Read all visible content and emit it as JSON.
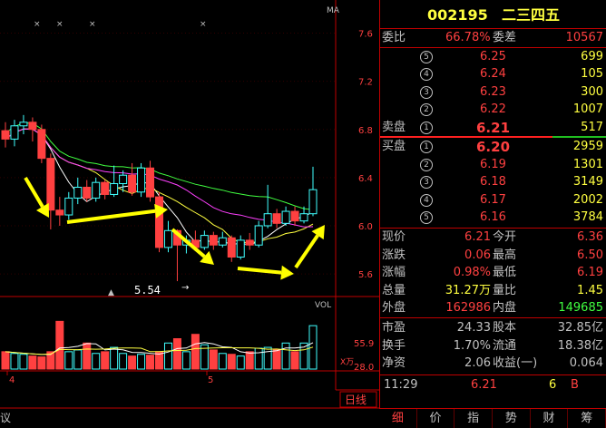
{
  "chart": {
    "ma_label": "MA",
    "price_ticks": [
      "7.6",
      "7.2",
      "6.8",
      "6.4",
      "6.0",
      "5.6"
    ],
    "vol_label": "VOL",
    "vol_ticks": [
      "55.9",
      "28.0"
    ],
    "vol_unit": "X万",
    "low_marker": "5.54",
    "date_labels": [
      "4",
      "5"
    ],
    "bottom_left": "议",
    "period_label": "日线",
    "up_color": "#40ffff",
    "down_color": "#ff4040"
  },
  "chart_data": {
    "type": "candlestick",
    "y_range": [
      5.45,
      7.8
    ],
    "candles": [
      {
        "o": 6.79,
        "c": 6.72,
        "h": 6.86,
        "l": 6.65
      },
      {
        "o": 6.72,
        "c": 6.83,
        "h": 6.88,
        "l": 6.66
      },
      {
        "o": 6.83,
        "c": 6.86,
        "h": 6.92,
        "l": 6.76
      },
      {
        "o": 6.86,
        "c": 6.8,
        "h": 6.9,
        "l": 6.7
      },
      {
        "o": 6.8,
        "c": 6.56,
        "h": 6.84,
        "l": 6.52
      },
      {
        "o": 6.56,
        "c": 6.13,
        "h": 6.6,
        "l": 5.97
      },
      {
        "o": 6.13,
        "c": 6.09,
        "h": 6.24,
        "l": 6.0
      },
      {
        "o": 6.09,
        "c": 6.23,
        "h": 6.28,
        "l": 6.05
      },
      {
        "o": 6.23,
        "c": 6.32,
        "h": 6.4,
        "l": 6.18
      },
      {
        "o": 6.32,
        "c": 6.23,
        "h": 6.38,
        "l": 6.2
      },
      {
        "o": 6.23,
        "c": 6.36,
        "h": 6.4,
        "l": 6.2
      },
      {
        "o": 6.36,
        "c": 6.26,
        "h": 6.38,
        "l": 6.22
      },
      {
        "o": 6.26,
        "c": 6.35,
        "h": 6.5,
        "l": 6.24
      },
      {
        "o": 6.35,
        "c": 6.42,
        "h": 6.46,
        "l": 6.28
      },
      {
        "o": 6.42,
        "c": 6.28,
        "h": 6.52,
        "l": 6.25
      },
      {
        "o": 6.28,
        "c": 6.48,
        "h": 6.52,
        "l": 6.24
      },
      {
        "o": 6.48,
        "c": 6.24,
        "h": 6.54,
        "l": 6.2
      },
      {
        "o": 6.24,
        "c": 5.82,
        "h": 6.28,
        "l": 5.78
      },
      {
        "o": 5.82,
        "c": 5.96,
        "h": 6.04,
        "l": 5.78
      },
      {
        "o": 5.96,
        "c": 5.84,
        "h": 5.97,
        "l": 5.54
      },
      {
        "o": 5.84,
        "c": 5.88,
        "h": 5.92,
        "l": 5.77
      },
      {
        "o": 5.88,
        "c": 5.82,
        "h": 5.96,
        "l": 5.79
      },
      {
        "o": 5.82,
        "c": 5.92,
        "h": 5.96,
        "l": 5.8
      },
      {
        "o": 5.92,
        "c": 5.84,
        "h": 5.95,
        "l": 5.8
      },
      {
        "o": 5.84,
        "c": 5.9,
        "h": 5.95,
        "l": 5.82
      },
      {
        "o": 5.9,
        "c": 5.74,
        "h": 5.92,
        "l": 5.7
      },
      {
        "o": 5.74,
        "c": 5.88,
        "h": 5.92,
        "l": 5.72
      },
      {
        "o": 5.88,
        "c": 5.84,
        "h": 5.94,
        "l": 5.8
      },
      {
        "o": 5.84,
        "c": 6.0,
        "h": 6.04,
        "l": 5.82
      },
      {
        "o": 6.0,
        "c": 6.1,
        "h": 6.34,
        "l": 5.98
      },
      {
        "o": 6.1,
        "c": 6.02,
        "h": 6.14,
        "l": 5.98
      },
      {
        "o": 6.02,
        "c": 6.12,
        "h": 6.16,
        "l": 6.0
      },
      {
        "o": 6.12,
        "c": 6.04,
        "h": 6.16,
        "l": 6.0
      },
      {
        "o": 6.04,
        "c": 6.1,
        "h": 6.16,
        "l": 6.02
      },
      {
        "o": 6.1,
        "c": 6.3,
        "h": 6.49,
        "l": 6.08
      }
    ],
    "volume_range": [
      0,
      70
    ],
    "volumes": [
      20,
      18,
      17,
      15,
      14,
      20,
      55,
      20,
      22,
      30,
      18,
      20,
      25,
      18,
      15,
      17,
      16,
      20,
      30,
      35,
      20,
      40,
      28,
      22,
      18,
      17,
      15,
      20,
      24,
      25,
      22,
      30,
      20,
      30,
      50
    ]
  },
  "quote": {
    "code": "002195",
    "name": "二三四五",
    "webi_label": "委比",
    "webi_value": "66.78%",
    "weicha_label": "委差",
    "weicha_value": "10567",
    "sell_label": "卖盘",
    "buy_label": "买盘",
    "sells": [
      {
        "n": "5",
        "price": "6.25",
        "vol": "699"
      },
      {
        "n": "4",
        "price": "6.24",
        "vol": "105"
      },
      {
        "n": "3",
        "price": "6.23",
        "vol": "300"
      },
      {
        "n": "2",
        "price": "6.22",
        "vol": "1007"
      },
      {
        "n": "1",
        "price": "6.21",
        "vol": "517"
      }
    ],
    "buys": [
      {
        "n": "1",
        "price": "6.20",
        "vol": "2959"
      },
      {
        "n": "2",
        "price": "6.19",
        "vol": "1301"
      },
      {
        "n": "3",
        "price": "6.18",
        "vol": "3149"
      },
      {
        "n": "4",
        "price": "6.17",
        "vol": "2002"
      },
      {
        "n": "5",
        "price": "6.16",
        "vol": "3784"
      }
    ],
    "stats": [
      {
        "l1": "现价",
        "v1": "6.21",
        "l2": "今开",
        "v2": "6.36"
      },
      {
        "l1": "涨跌",
        "v1": "0.06",
        "l2": "最高",
        "v2": "6.50"
      },
      {
        "l1": "涨幅",
        "v1": "0.98%",
        "l2": "最低",
        "v2": "6.19"
      },
      {
        "l1": "总量",
        "v1": "31.27万",
        "l2": "量比",
        "v2": "1.45"
      },
      {
        "l1": "外盘",
        "v1": "162986",
        "l2": "内盘",
        "v2": "149685"
      }
    ],
    "fund": [
      {
        "l1": "市盈",
        "v1": "24.33",
        "l2": "股本",
        "v2": "32.85亿"
      },
      {
        "l1": "换手",
        "v1": "1.70%",
        "l2": "流通",
        "v2": "18.38亿"
      },
      {
        "l1": "净资",
        "v1": "2.06",
        "l2": "收益(一)",
        "v2": "0.064"
      }
    ],
    "tick": {
      "time": "11:29",
      "price": "6.21",
      "vol": "6",
      "side": "B"
    }
  },
  "tabs": [
    "细",
    "价",
    "指",
    "势",
    "财",
    "筹"
  ]
}
